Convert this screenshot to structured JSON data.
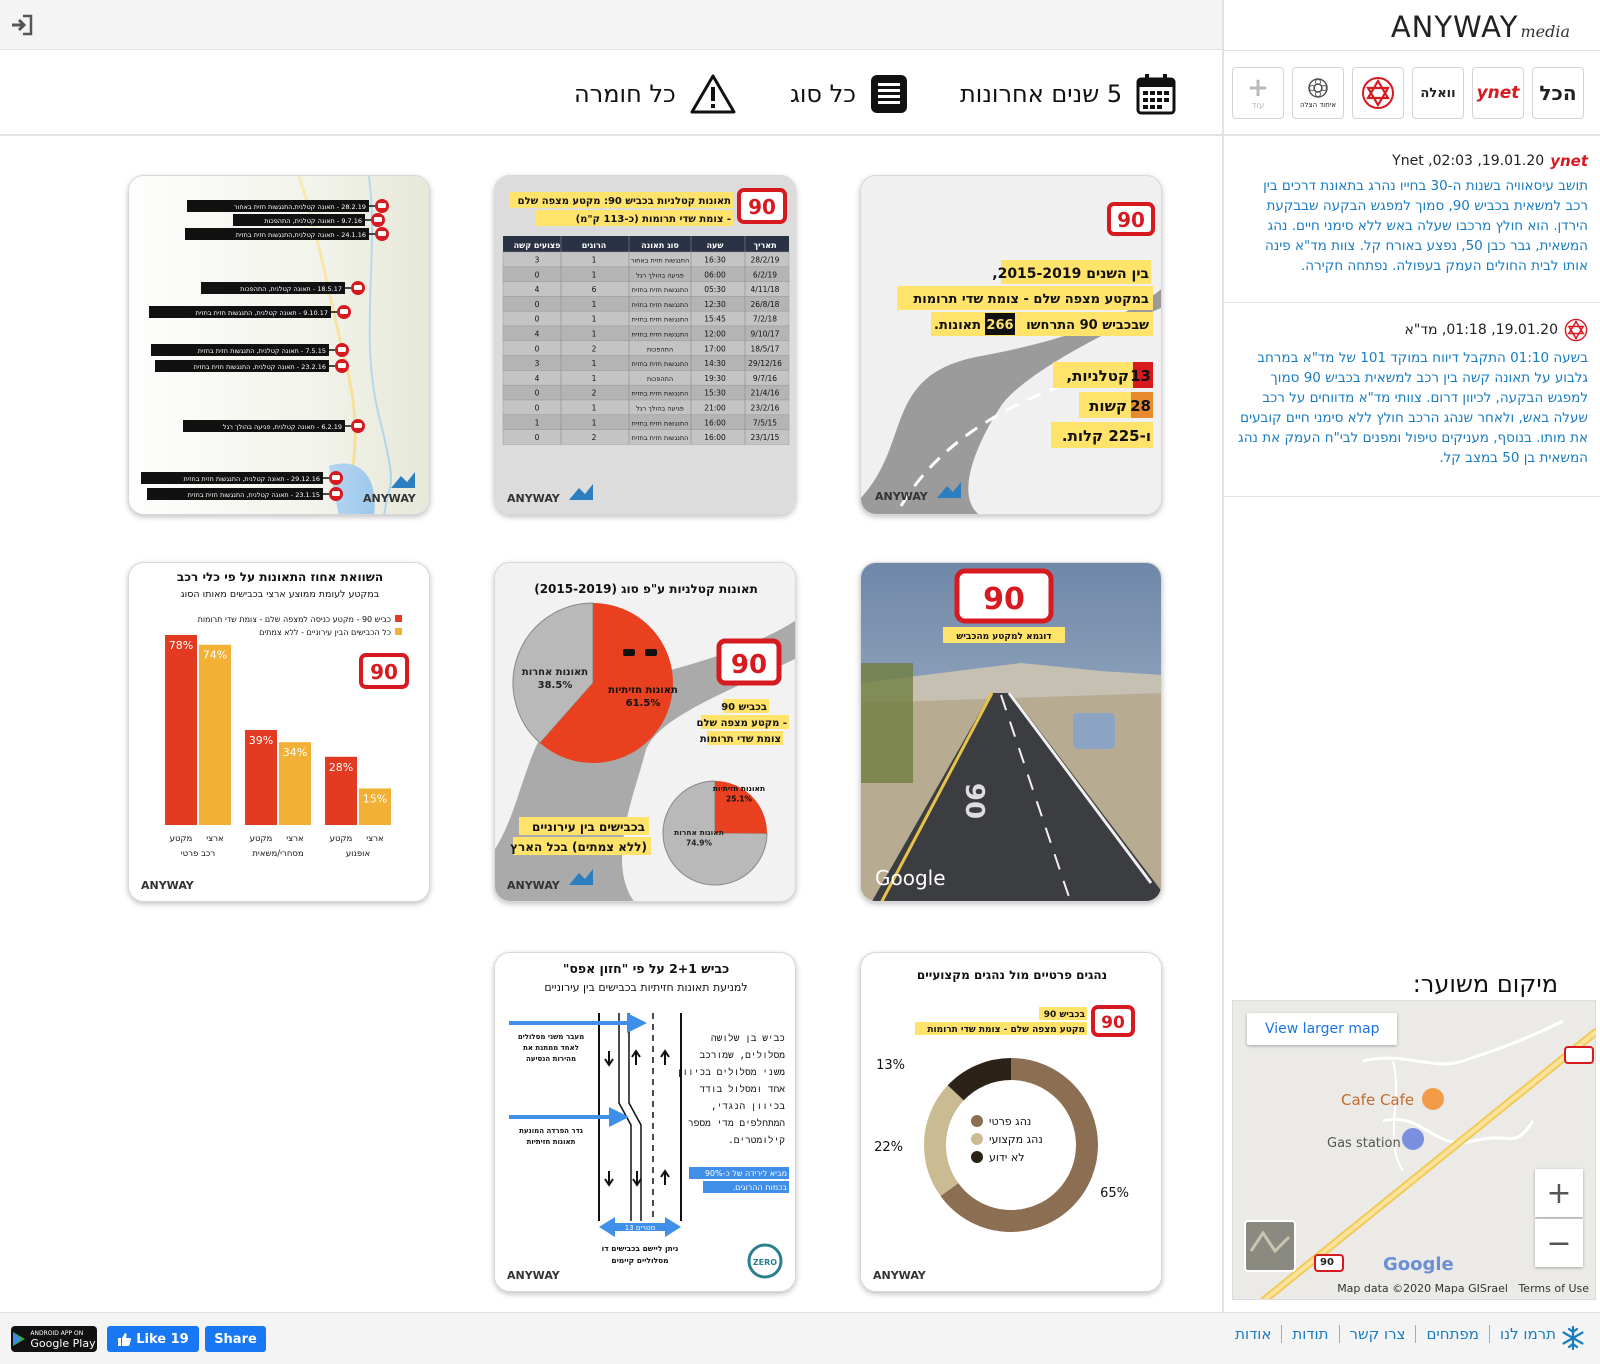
{
  "topbar": {
    "login_icon": "sign-in-icon"
  },
  "filters": {
    "date": {
      "label": "5 שנים אחרונות",
      "icon": "calendar-icon"
    },
    "type": {
      "label": "כל סוג",
      "icon": "list-icon"
    },
    "severity": {
      "label": "כל חומרה",
      "icon": "warning-icon"
    }
  },
  "logo": {
    "brand": "ANYWAY",
    "sub": "media"
  },
  "sources": {
    "all_label": "הכל",
    "ynet_label": "ynet",
    "walla_label": "וואלה",
    "mda_icon": "magen-david-icon",
    "ichud_label": "איחוד הצלה",
    "more_label": "עוד"
  },
  "news": [
    {
      "source_icon": "ynet",
      "header": "Ynet ,02:03 ,19.01.20",
      "body": "תושב עיסאוויה בשנות ה-30 בחייו נהרג בתאונת דרכים בין רכב למשאית בכביש 90, סמוך למפגש הבקעה שבבקעת הירדן. הוא חולץ מרכבו שעלה באש ללא סימני חיים. נהג המשאית, גבר כבן 50, נפצע באורח קל. צוות מד\"א פינה אותו לבית החולים העמק בעפולה. נפתחה חקירה."
    },
    {
      "source_icon": "mda",
      "header": "19.01.20, 01:18, מד\"א",
      "body": "בשעה 01:10 התקבל דיווח במוקד 101 של מד\"א במרחב גלבוע על תאונה קשה בין רכב למשאית בכביש 90 סמוך למפגש הבקעה, לכיוון דרום. צוותי מד\"א מדווחים על רכב שעלה באש, ולאחר שנהג הרכב חולץ ללא סימני חיים קובעים את מותו. בנוסף, מעניקים טיפול ומפנים לבי\"ח העמק את נהג המשאית בן 50 במצב קל."
    }
  ],
  "location": {
    "title": "מיקום משוער:"
  },
  "map": {
    "larger_map": "View larger map",
    "cafe": "Cafe Cafe",
    "gas": "Gas station",
    "road_num": "90",
    "google": "Google",
    "attribution": "Map data ©2020 Mapa GISrael",
    "terms": "Terms of Use",
    "zoom_in": "+",
    "zoom_out": "−"
  },
  "footer": {
    "google_play_small": "ANDROID APP ON",
    "google_play": "Google Play",
    "like": "Like 19",
    "share": "Share",
    "links": [
      "תרמו לנו",
      "מפתחים",
      "צרו קשר",
      "תודות",
      "אודות"
    ]
  },
  "cards": {
    "c1": {
      "road": "90",
      "l1": "בין השנים 2015-2019,",
      "l2": "במקטע מצפה שלם - צומת שדי תרומות",
      "l3a": "שבכביש 90 התרחשו",
      "l3n": "266",
      "l3b": "תאונות.",
      "s1n": "13",
      "s1": "קטלניות,",
      "s2n": "28",
      "s2": "קשות",
      "s3": "ו-225 קלות.",
      "brand": "ANYWAY"
    },
    "c2": {
      "road": "90",
      "title1": "תאונות קטלניות בכביש 90: מקטע מצפה שלם",
      "title2": "- צומת שדי תרומות (כ-113 ק\"מ)",
      "headers": [
        "תאריך",
        "שעה",
        "סוג תאונה",
        "הרוגים",
        "פצועים קשה"
      ],
      "rows": [
        [
          "28/2/19",
          "16:30",
          "התנגשות חזית באחור",
          "1",
          "3"
        ],
        [
          "6/2/19",
          "06:00",
          "פגיעה בהולך רגל",
          "1",
          "0"
        ],
        [
          "4/11/18",
          "05:30",
          "התנגשות חזית בחזית",
          "6",
          "4"
        ],
        [
          "26/8/18",
          "12:30",
          "התנגשות חזית בחזית",
          "1",
          "0"
        ],
        [
          "7/2/18",
          "15:45",
          "התנגשות חזית בחזית",
          "1",
          "0"
        ],
        [
          "9/10/17",
          "12:00",
          "התנגשות חזית בחזית",
          "1",
          "4"
        ],
        [
          "18/5/17",
          "17:00",
          "התהפכות",
          "2",
          "0"
        ],
        [
          "29/12/16",
          "14:30",
          "התנגשות חזית בחזית",
          "1",
          "3"
        ],
        [
          "9/7/16",
          "19:30",
          "התהפכות",
          "1",
          "4"
        ],
        [
          "21/4/16",
          "15:30",
          "התנגשות חזית בחזית",
          "2",
          "0"
        ],
        [
          "23/2/16",
          "21:00",
          "פגיעה בהולך רגל",
          "1",
          "0"
        ],
        [
          "7/5/15",
          "16:00",
          "התנגשות חזית בחזית",
          "1",
          "1"
        ],
        [
          "23/1/15",
          "16:00",
          "התנגשות חזית בחזית",
          "2",
          "0"
        ]
      ],
      "brand": "ANYWAY"
    },
    "c3": {
      "labels": [
        "28.2.19 - תאונה קטלנית,התנגשות חזית באחור",
        "9.7.16 - תאונה קטלנית, התהפכות",
        "24.1.16 - תאונה קטלנית,התנגשות חזית בחזית",
        "18.5.17 - תאונה קטלנית, התהפכות",
        "9.10.17 - תאונה קטלנית, התנגשות חזית בחזית",
        "7.5.15 - תאונה קטלנית, התנגשות חזית בחזית",
        "23.2.16 - תאונה קטלנית, התנגשות חזית בחזית",
        "6.2.19 - תאונה קטלנית, פגיעה בהולך רגל",
        "29.12.16 - תאונה קטלנית, התנגשות חזית בחזית",
        "23.1.15 - תאונה קטלנית, התנגשות חזית בחזית"
      ],
      "brand": "ANYWAY"
    },
    "c4": {
      "road": "90",
      "caption": "דוגמא למקטע מהכביש",
      "google": "Google",
      "painted": "90"
    },
    "c5": {
      "title": "תאונות קטלניות ע\"פ סוג (2015-2019)",
      "road": "90",
      "big_a_label": "תאונות חזיתיות",
      "big_a_pct": "61.5%",
      "big_b_label": "תאונות אחרות",
      "big_b_pct": "38.5%",
      "mid1": "בכביש 90",
      "mid2": "- מקטע מצפה שלם",
      "mid3": "צומת שדי תרומות",
      "bot1": "בכבישים בין עירוניים",
      "bot2": "(ללא צמתים) בכל הארץ",
      "small_a_label": "תאונות חזיתיות",
      "small_a_pct": "25.1%",
      "small_b_label": "תאונות אחרות",
      "small_b_pct": "74.9%",
      "brand": "ANYWAY"
    },
    "c6": {
      "title": "השוואת אחוז התאונות על פי כלי רכב",
      "subtitle": "במקטע לעומת ממוצע ארצי בכבישים מאותו הסוג",
      "legend1": "כביש 90 - מקטע כניסה למצפה שלם - צומת שדי תרומות",
      "legend2": "כל הכבישים הבין עירוניים - ללא צמתים",
      "road": "90",
      "bars": [
        {
          "a": "78%",
          "b": "74%"
        },
        {
          "a": "39%",
          "b": "34%"
        },
        {
          "a": "28%",
          "b": "15%"
        }
      ],
      "groups": [
        {
          "seg": "מקטע",
          "nat": "ארצי",
          "name": "רכב פרטי"
        },
        {
          "seg": "מקטע",
          "nat": "ארצי",
          "name": "מסחרי/משאית"
        },
        {
          "seg": "מקטע",
          "nat": "ארצי",
          "name": "אופנוע"
        }
      ],
      "brand": "ANYWAY"
    },
    "c7": {
      "title": "נהגים פרטיים מול נהגים מקצועיים",
      "road": "90",
      "sub1": "בכביש 90",
      "sub2": "מקטע מצפה שלם - צומת שדי תרומות",
      "pct_a": "65%",
      "pct_b": "22%",
      "pct_c": "13%",
      "leg_a": "נהג פרטי",
      "leg_b": "נהג מקצועי",
      "leg_c": "לא ידוע",
      "brand": "ANYWAY"
    },
    "c8": {
      "title": "כביש 2+1 על פי \"חזון אפס\"",
      "subtitle": "למניעת תאונות חזיתיות בכבישים בין עירוניים",
      "arrow1": "מעבר משני מסלולים לאחד ממתנת את מהירות הנסיעה",
      "arrow2": "גדר הפרדה המונעת תאונות חזיתיות",
      "desc": [
        "כביש בן שלושה",
        "מסלולים, שמורכב",
        "משני מסלולים בכיוון",
        "אחד ומסלול בודד",
        "בכיוון הנגדי,",
        "המתחלפים מדי מספר",
        "קילומטרים."
      ],
      "hl1": "מביא לירידה של כ-90%",
      "hl2": "בכמות ההרוגים.",
      "width": "13 מטרים",
      "bottom1": "ניתן ליישם בכבישים דו",
      "bottom2": "מסלוליים קיימים",
      "zero": "ZERO",
      "brand": "ANYWAY"
    }
  }
}
